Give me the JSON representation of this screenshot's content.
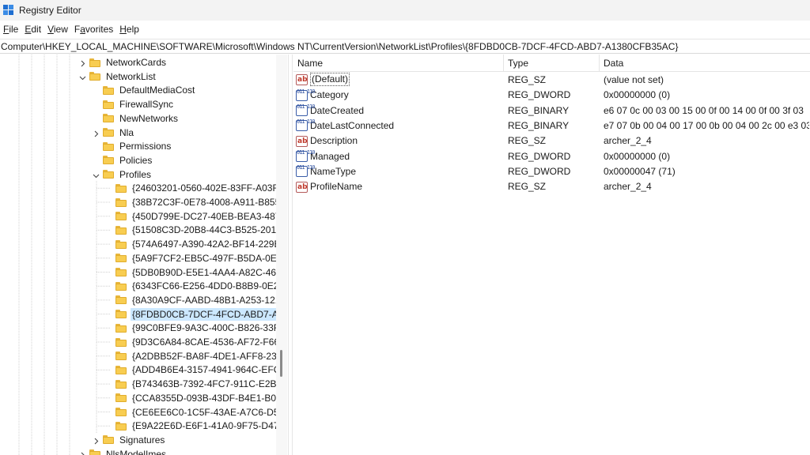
{
  "window": {
    "title": "Registry Editor"
  },
  "menu": [
    {
      "accel": "F",
      "rest": "ile"
    },
    {
      "accel": "E",
      "rest": "dit"
    },
    {
      "accel": "V",
      "rest": "iew"
    },
    {
      "accel": "",
      "prefix": "F",
      "accel2": "a",
      "rest": "vorites"
    },
    {
      "accel": "H",
      "rest": "elp"
    }
  ],
  "address": "Computer\\HKEY_LOCAL_MACHINE\\SOFTWARE\\Microsoft\\Windows NT\\CurrentVersion\\NetworkList\\Profiles\\{8FDBD0CB-7DCF-4FCD-ABD7-A1380CFB35AC}",
  "tree": {
    "items": [
      {
        "label": "NetworkCards",
        "level": 0,
        "expander": "collapsed"
      },
      {
        "label": "NetworkList",
        "level": 0,
        "expander": "expanded"
      },
      {
        "label": "DefaultMediaCost",
        "level": 1,
        "expander": "none"
      },
      {
        "label": "FirewallSync",
        "level": 1,
        "expander": "none"
      },
      {
        "label": "NewNetworks",
        "level": 1,
        "expander": "none"
      },
      {
        "label": "Nla",
        "level": 1,
        "expander": "collapsed"
      },
      {
        "label": "Permissions",
        "level": 1,
        "expander": "none"
      },
      {
        "label": "Policies",
        "level": 1,
        "expander": "none"
      },
      {
        "label": "Profiles",
        "level": 1,
        "expander": "expanded"
      },
      {
        "label": "{24603201-0560-402E-83FF-A03F8",
        "level": 2,
        "expander": "none"
      },
      {
        "label": "{38B72C3F-0E78-4008-A911-B855",
        "level": 2,
        "expander": "none"
      },
      {
        "label": "{450D799E-DC27-40EB-BEA3-487I",
        "level": 2,
        "expander": "none"
      },
      {
        "label": "{51508C3D-20B8-44C3-B525-2012",
        "level": 2,
        "expander": "none"
      },
      {
        "label": "{574A6497-A390-42A2-BF14-229B",
        "level": 2,
        "expander": "none"
      },
      {
        "label": "{5A9F7CF2-EB5C-497F-B5DA-0E91",
        "level": 2,
        "expander": "none"
      },
      {
        "label": "{5DB0B90D-E5E1-4AA4-A82C-464",
        "level": 2,
        "expander": "none"
      },
      {
        "label": "{6343FC66-E256-4DD0-B8B9-0E2E",
        "level": 2,
        "expander": "none"
      },
      {
        "label": "{8A30A9CF-AABD-48B1-A253-121",
        "level": 2,
        "expander": "none"
      },
      {
        "label": "{8FDBD0CB-7DCF-4FCD-ABD7-A1",
        "level": 2,
        "expander": "none",
        "selected": true
      },
      {
        "label": "{99C0BFE9-9A3C-400C-B826-33F7",
        "level": 2,
        "expander": "none"
      },
      {
        "label": "{9D3C6A84-8CAE-4536-AF72-F661",
        "level": 2,
        "expander": "none"
      },
      {
        "label": "{A2DBB52F-BA8F-4DE1-AFF8-2331",
        "level": 2,
        "expander": "none"
      },
      {
        "label": "{ADD4B6E4-3157-4941-964C-EFC7",
        "level": 2,
        "expander": "none"
      },
      {
        "label": "{B743463B-7392-4FC7-911C-E2BE",
        "level": 2,
        "expander": "none"
      },
      {
        "label": "{CCA8355D-093B-43DF-B4E1-B0A",
        "level": 2,
        "expander": "none"
      },
      {
        "label": "{CE6EE6C0-1C5F-43AE-A7C6-D5D",
        "level": 2,
        "expander": "none"
      },
      {
        "label": "{E9A22E6D-E6F1-41A0-9F75-D47C",
        "level": 2,
        "expander": "none"
      },
      {
        "label": "Signatures",
        "level": 1,
        "expander": "collapsed"
      },
      {
        "label": "NlsModelImes",
        "level": 0,
        "expander": "collapsed"
      }
    ]
  },
  "values": {
    "headers": {
      "name": "Name",
      "type": "Type",
      "data": "Data"
    },
    "rows": [
      {
        "icon": "string-value-icon",
        "kind": "sz",
        "name": "(Default)",
        "type": "REG_SZ",
        "data": "(value not set)",
        "is_default": true
      },
      {
        "icon": "binary-value-icon",
        "kind": "bin",
        "name": "Category",
        "type": "REG_DWORD",
        "data": "0x00000000 (0)"
      },
      {
        "icon": "binary-value-icon",
        "kind": "bin",
        "name": "DateCreated",
        "type": "REG_BINARY",
        "data": "e6 07 0c 00 03 00 15 00 0f 00 14 00 0f 00 3f 03"
      },
      {
        "icon": "binary-value-icon",
        "kind": "bin",
        "name": "DateLastConnected",
        "type": "REG_BINARY",
        "data": "e7 07 0b 00 04 00 17 00 0b 00 04 00 2c 00 e3 03"
      },
      {
        "icon": "string-value-icon",
        "kind": "sz",
        "name": "Description",
        "type": "REG_SZ",
        "data": "archer_2_4"
      },
      {
        "icon": "binary-value-icon",
        "kind": "bin",
        "name": "Managed",
        "type": "REG_DWORD",
        "data": "0x00000000 (0)"
      },
      {
        "icon": "binary-value-icon",
        "kind": "bin",
        "name": "NameType",
        "type": "REG_DWORD",
        "data": "0x00000047 (71)"
      },
      {
        "icon": "string-value-icon",
        "kind": "sz",
        "name": "ProfileName",
        "type": "REG_SZ",
        "data": "archer_2_4"
      }
    ]
  },
  "icon_glyphs": {
    "sz": "ab",
    "bin": "011 110"
  },
  "colors": {
    "selection": "#cce8ff",
    "folder": "#f8cd51",
    "folder_border": "#e0ac2c"
  }
}
